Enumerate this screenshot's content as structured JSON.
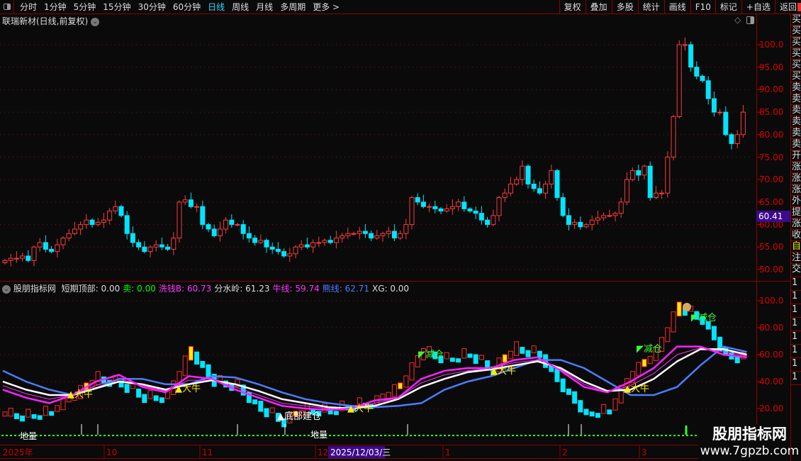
{
  "toolbar": {
    "periods": [
      "分时",
      "1分钟",
      "5分钟",
      "15分钟",
      "30分钟",
      "60分钟",
      "日线",
      "周线",
      "月线",
      "多周期",
      "更多 >"
    ],
    "active": "日线",
    "right_buttons": [
      "复权",
      "叠加",
      "多股",
      "统计",
      "画线",
      "F10",
      "标记",
      "+自选",
      "返回"
    ]
  },
  "title": "联瑞新材(日线,前复权)",
  "price_axis": [
    "100.0",
    "95.00",
    "90.00",
    "85.00",
    "80.00",
    "75.00",
    "70.00",
    "65.00",
    "60.00",
    "55.00",
    "50.00"
  ],
  "current_price": "60.41",
  "indicator": {
    "name": "股朋指标网",
    "items": [
      {
        "label": "短期顶部:",
        "value": "0.00",
        "color": "#dddddd"
      },
      {
        "label": "卖:",
        "value": "0.00",
        "color": "#00ff00"
      },
      {
        "label": "洗钱B:",
        "value": "60.73",
        "color": "#ff33ff"
      },
      {
        "label": "分水岭:",
        "value": "61.23",
        "color": "#dddddd"
      },
      {
        "label": "牛线:",
        "value": "59.74",
        "color": "#ff33ff"
      },
      {
        "label": "熊线:",
        "value": "62.71",
        "color": "#4a7dff"
      },
      {
        "label": "XG:",
        "value": "0.00",
        "color": "#dddddd"
      }
    ]
  },
  "ind_axis": [
    "100.0",
    "80.00",
    "60.00",
    "40.00",
    "20.00"
  ],
  "signals": {
    "bull": "大牛",
    "bottom": "底部建仓",
    "reduce": "减仓",
    "low_volume": "地量"
  },
  "dates": {
    "year": "2025年",
    "months": [
      "10",
      "11",
      "12",
      "1",
      "2",
      "3"
    ],
    "cursor": "2025/12/03/三"
  },
  "watermark": {
    "name": "股朋指标网",
    "url": "www.7gpzb.com"
  },
  "side_chars": [
    "买",
    "买",
    "买",
    "买",
    "买",
    "买",
    "卖",
    "卖",
    "卖",
    "卖",
    "卖",
    "卖",
    "开",
    "涨",
    "涨",
    "涨",
    "外",
    "提",
    "涨",
    "收",
    "自",
    "注",
    "交",
    "1",
    "1",
    "1",
    "1",
    "1",
    "1",
    "1",
    "1"
  ],
  "chart_data": {
    "type": "candlestick",
    "ylim": [
      48,
      104
    ],
    "closes": [
      52,
      52.5,
      52.5,
      53,
      52,
      55,
      56,
      54.5,
      54,
      55.5,
      57,
      58,
      59,
      60,
      61,
      60,
      60.5,
      61,
      63,
      64,
      62,
      58,
      56,
      55,
      54,
      55,
      55.5,
      55,
      54.5,
      57,
      65,
      65.5,
      64,
      64,
      60,
      59,
      57.5,
      59,
      61,
      60,
      60,
      58,
      57,
      56,
      56.5,
      55,
      54.5,
      54,
      53,
      53.5,
      55,
      55.5,
      55,
      56,
      56,
      56.5,
      56,
      57,
      57.5,
      58,
      58,
      58.5,
      58,
      57,
      57.5,
      58,
      58.5,
      57,
      58,
      60,
      66,
      65,
      64,
      64,
      63.5,
      63,
      63.5,
      64,
      65,
      63.5,
      63,
      62.5,
      61,
      60,
      62,
      66,
      67,
      69,
      70,
      73,
      69,
      68,
      67,
      69,
      72,
      66,
      62,
      60,
      60.5,
      59.5,
      60,
      61,
      61.5,
      62,
      62,
      62.5,
      65,
      70,
      72,
      71,
      73,
      66,
      67,
      67,
      75,
      84,
      100,
      100,
      95,
      93,
      92,
      88,
      85,
      85,
      80,
      78,
      80,
      85
    ],
    "indicator_ylim": [
      12,
      108
    ],
    "oscillator": [
      15,
      14,
      17,
      28,
      42,
      38,
      28,
      28,
      62,
      40,
      36,
      20,
      10,
      18,
      18,
      22,
      24,
      35,
      62,
      56,
      60,
      48,
      64,
      60,
      36,
      16,
      18,
      45,
      60,
      95,
      86,
      60,
      55
    ],
    "lines": {
      "bear_blue": [
        48,
        40,
        34,
        30,
        35,
        42,
        42,
        38,
        38,
        44,
        43,
        38,
        32,
        27,
        24,
        22,
        21,
        22,
        24,
        34,
        40,
        44,
        50,
        56,
        56,
        50,
        40,
        30,
        30,
        36,
        52,
        66,
        62
      ],
      "divide_white": [
        40,
        34,
        30,
        30,
        35,
        40,
        38,
        34,
        38,
        41,
        38,
        33,
        27,
        24,
        21,
        20,
        22,
        27,
        36,
        42,
        47,
        49,
        52,
        55,
        50,
        40,
        33,
        34,
        42,
        55,
        64,
        64,
        60
      ],
      "bull_magenta": [
        34,
        28,
        24,
        30,
        40,
        45,
        36,
        32,
        44,
        42,
        34,
        28,
        22,
        20,
        19,
        20,
        26,
        28,
        42,
        48,
        50,
        50,
        56,
        58,
        48,
        36,
        32,
        40,
        50,
        66,
        66,
        60,
        58
      ],
      "wash_thin": [
        37,
        31,
        27,
        30,
        37,
        42,
        37,
        33,
        41,
        41,
        36,
        30,
        24,
        22,
        20,
        20,
        24,
        28,
        39,
        45,
        48,
        50,
        54,
        56,
        49,
        38,
        32,
        37,
        46,
        60,
        65,
        62,
        59
      ]
    }
  }
}
